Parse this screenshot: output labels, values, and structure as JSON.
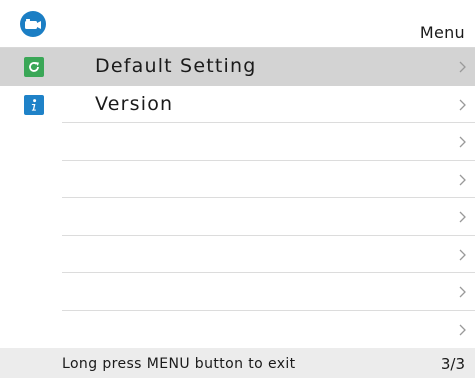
{
  "header": {
    "title": "Menu",
    "app_icon": "camera-app-icon",
    "app_icon_color": "#1b7ec4"
  },
  "menu": {
    "items": [
      {
        "label": "Default Setting",
        "icon": "refresh-icon",
        "icon_color": "#3aa757",
        "selected": true
      },
      {
        "label": "Version",
        "icon": "info-icon",
        "icon_color": "#1f82c8",
        "selected": false
      },
      {
        "label": "",
        "icon": "",
        "selected": false
      },
      {
        "label": "",
        "icon": "",
        "selected": false
      },
      {
        "label": "",
        "icon": "",
        "selected": false
      },
      {
        "label": "",
        "icon": "",
        "selected": false
      },
      {
        "label": "",
        "icon": "",
        "selected": false
      },
      {
        "label": "",
        "icon": "",
        "selected": false
      }
    ],
    "selected_color": "#d3d3d3"
  },
  "footer": {
    "hint": "Long press MENU button to exit",
    "page": "3/3"
  }
}
